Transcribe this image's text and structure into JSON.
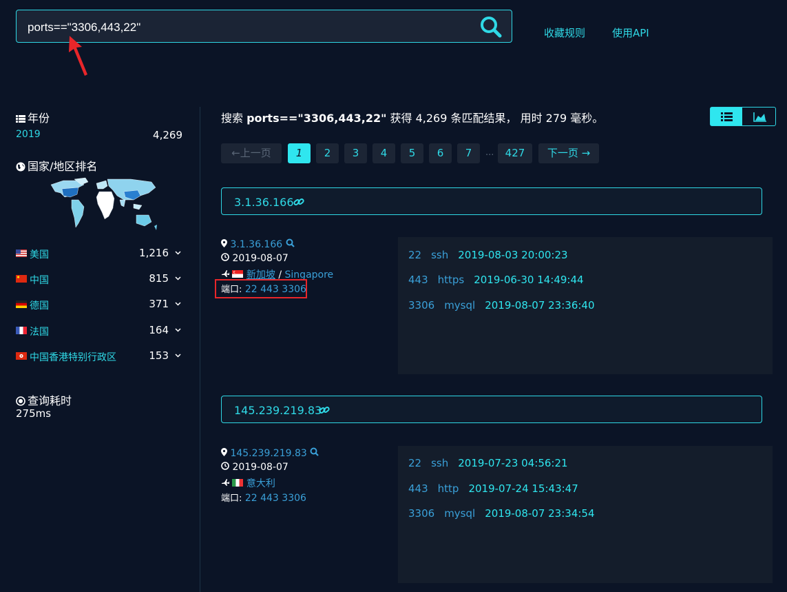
{
  "search": {
    "query": "ports==\"3306,443,22\""
  },
  "top_links": {
    "favorite_rules": "收藏规则",
    "use_api": "使用API"
  },
  "sidebar": {
    "year_title": "年份",
    "year": {
      "label": "2019",
      "count": "4,269"
    },
    "country_title": "国家/地区排名",
    "countries": [
      {
        "name": "美国",
        "count": "1,216"
      },
      {
        "name": "中国",
        "count": "815"
      },
      {
        "name": "德国",
        "count": "371"
      },
      {
        "name": "法国",
        "count": "164"
      },
      {
        "name": "中国香港特别行政区",
        "count": "153"
      }
    ],
    "query_time_title": "查询耗时",
    "query_time": "275ms"
  },
  "summary": {
    "prefix": "搜索 ",
    "query": "ports==\"3306,443,22\"",
    "middle": " 获得 4,269 条匹配结果， 用时 279 毫秒。"
  },
  "pagination": {
    "prev": "←上一页",
    "pages": [
      "1",
      "2",
      "3",
      "4",
      "5",
      "6",
      "7"
    ],
    "ellipsis": "...",
    "last": "427",
    "next": "下一页 →"
  },
  "results": [
    {
      "ip": "3.1.36.166",
      "date": "2019-08-07",
      "location_cn": "新加坡",
      "separator": "/",
      "location_en": "Singapore",
      "ports_label": "端口:",
      "ports": "22 443 3306",
      "services": [
        {
          "port": "22",
          "proto": "ssh",
          "time": "2019-08-03 20:00:23"
        },
        {
          "port": "443",
          "proto": "https",
          "time": "2019-06-30 14:49:44"
        },
        {
          "port": "3306",
          "proto": "mysql",
          "time": "2019-08-07 23:36:40"
        }
      ]
    },
    {
      "ip": "145.239.219.83",
      "date": "2019-08-07",
      "location_cn": "意大利",
      "ports_label": "端口:",
      "ports": "22 443 3306",
      "services": [
        {
          "port": "22",
          "proto": "ssh",
          "time": "2019-07-23 04:56:21"
        },
        {
          "port": "443",
          "proto": "http",
          "time": "2019-07-24 15:43:47"
        },
        {
          "port": "3306",
          "proto": "mysql",
          "time": "2019-08-07 23:34:54"
        }
      ]
    }
  ],
  "colors": {
    "accent": "#2fd9e6",
    "background": "#0b1426",
    "annotation_red": "#e8262a"
  }
}
